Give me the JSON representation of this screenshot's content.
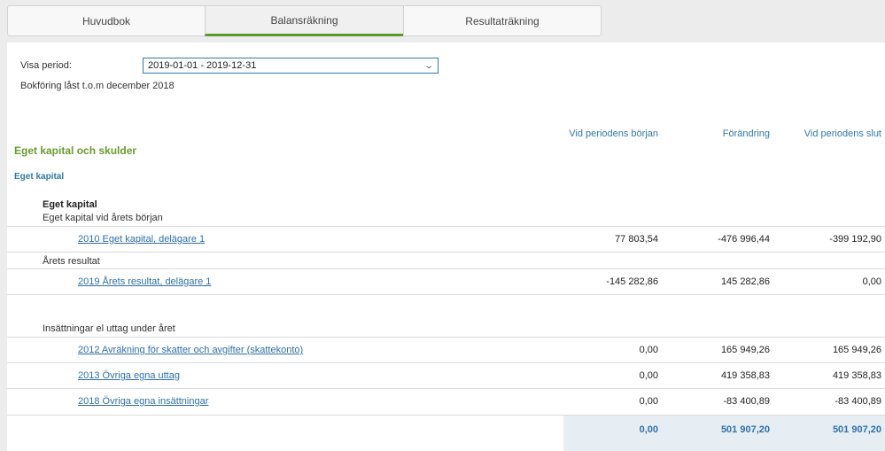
{
  "tabs": [
    "Huvudbok",
    "Balansräkning",
    "Resultaträkning"
  ],
  "active_tab": "Balansräkning",
  "accent_color": "#5c9a2c",
  "link_color": "#2f6fa8",
  "period": {
    "label": "Visa period:",
    "value": "2019-01-01 - 2019-12-31"
  },
  "locked_text": "Bokföring låst t.o.m december 2018",
  "columns": [
    "Vid periodens början",
    "Förändring",
    "Vid periodens slut"
  ],
  "section_title": "Eget kapital och skulder",
  "subsection_title": "Eget kapital",
  "group_title": "Eget kapital",
  "groups": [
    {
      "label": "Eget kapital vid årets början",
      "rows": [
        {
          "account": "2010 Eget kapital, delägare 1",
          "start": "77 803,54",
          "change": "-476 996,44",
          "end": "-399 192,90"
        }
      ]
    },
    {
      "label": "Årets resultat",
      "rows": [
        {
          "account": "2019 Årets resultat, delägare 1",
          "start": "-145 282,86",
          "change": "145 282,86",
          "end": "0,00"
        }
      ]
    },
    {
      "label": "Insättningar el uttag under året",
      "rows": [
        {
          "account": "2012 Avräkning för skatter och avgifter (skattekonto)",
          "start": "0,00",
          "change": "165 949,26",
          "end": "165 949,26"
        },
        {
          "account": "2013 Övriga egna uttag",
          "start": "0,00",
          "change": "419 358,83",
          "end": "419 358,83"
        },
        {
          "account": "2018 Övriga egna insättningar",
          "start": "0,00",
          "change": "-83 400,89",
          "end": "-83 400,89"
        }
      ]
    }
  ],
  "totals": {
    "start": "0,00",
    "change": "501 907,20",
    "end": "501 907,20"
  }
}
